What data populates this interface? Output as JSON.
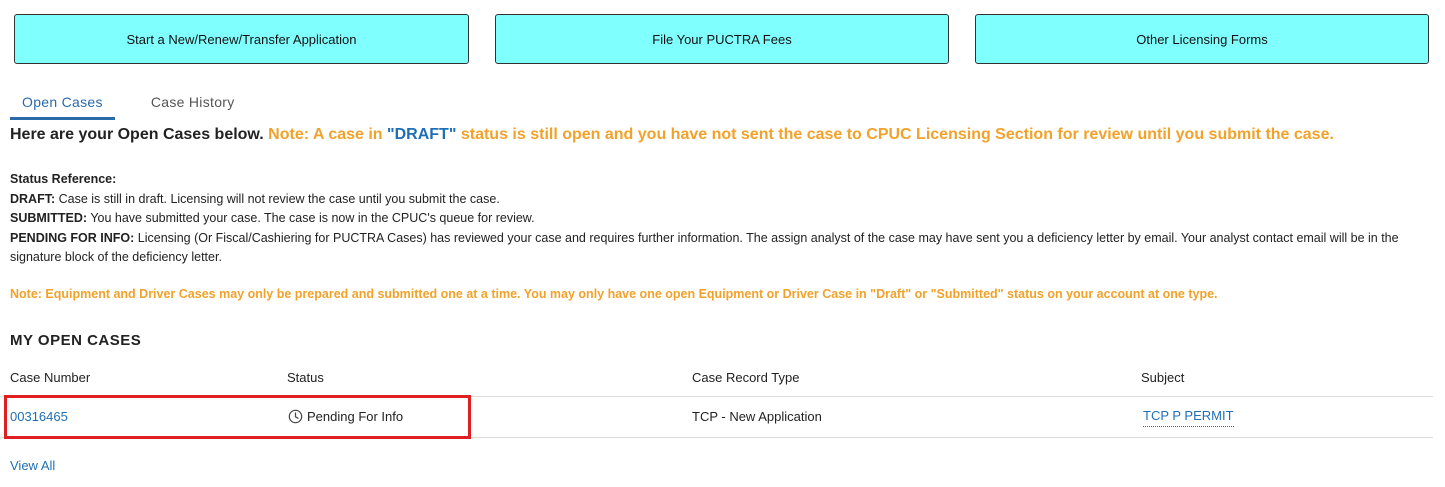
{
  "actions": {
    "new_application": "Start a New/Renew/Transfer Application",
    "file_fees": "File Your PUCTRA Fees",
    "other_forms": "Other Licensing Forms"
  },
  "tabs": [
    {
      "label": "Open Cases",
      "active": true
    },
    {
      "label": "Case History",
      "active": false
    }
  ],
  "heading": {
    "main": "Here are your Open Cases below. ",
    "note_prefix": "Note: A case in ",
    "draft_word": "\"DRAFT\"",
    "note_suffix": " status is still open and you have not sent the case to CPUC Licensing Section for review until you submit the case."
  },
  "status_reference": {
    "title": "Status Reference:",
    "draft_label": "DRAFT:",
    "draft_text": " Case is still in draft.  Licensing will not review the case until you submit the case.",
    "submitted_label": "SUBMITTED:",
    "submitted_text": " You have submitted your case.  The case is now in the CPUC's queue for review.",
    "pending_label": "PENDING FOR INFO:",
    "pending_text": " Licensing (Or Fiscal/Cashiering for PUCTRA Cases) has reviewed your case and requires further information.  The assign analyst of the case may have sent you a deficiency letter by email.  Your analyst contact email will be in the signature block of the deficiency letter."
  },
  "equipment_note": "Note: Equipment and Driver Cases may only be prepared and submitted one at a time.  You may only have one open Equipment or Driver Case in \"Draft\" or \"Submitted\" status on your account at one type.",
  "open_cases": {
    "title": "MY OPEN CASES",
    "columns": [
      "Case Number",
      "Status",
      "Case Record Type",
      "Subject"
    ],
    "rows": [
      {
        "case_number": "00316465",
        "status": "Pending For Info",
        "record_type": "TCP - New Application",
        "subject": "TCP P PERMIT"
      }
    ],
    "view_all": "View All"
  },
  "colors": {
    "action_button_bg": "#80ffff",
    "accent_blue": "#1f6fb5",
    "note_orange": "#f2a22a",
    "highlight_red": "#e02020"
  }
}
